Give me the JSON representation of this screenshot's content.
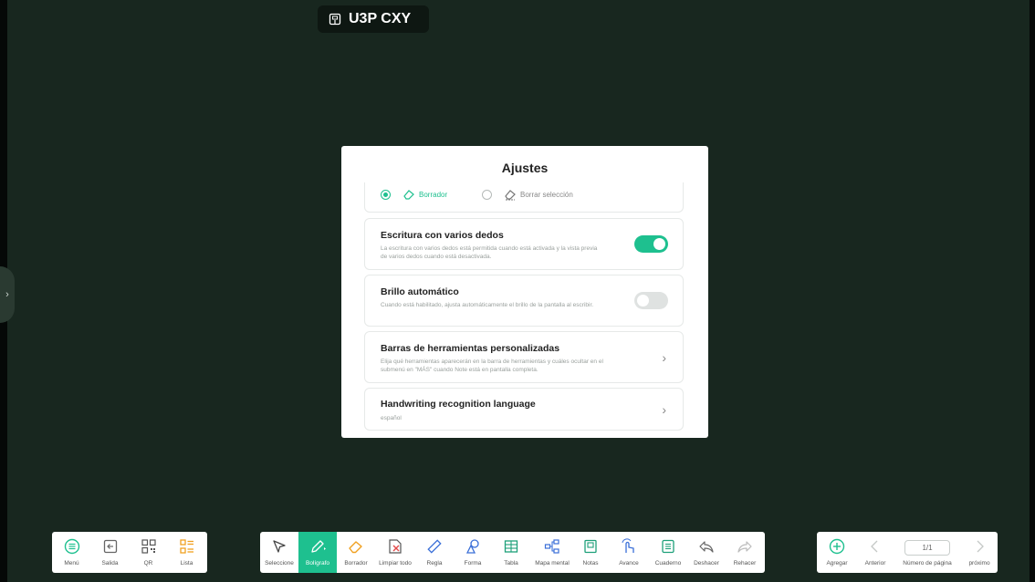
{
  "room": {
    "code": "U3P CXY"
  },
  "dialog": {
    "title": "Ajustes",
    "eraser": {
      "options": [
        {
          "label": "Borrador",
          "selected": true
        },
        {
          "label": "Borrar selección",
          "selected": false
        }
      ]
    },
    "settings": [
      {
        "title": "Escritura con varios dedos",
        "description": "La escritura con varios dedos está permitida cuando está activada y la vista previa de varios dedos cuando está desactivada.",
        "control": "toggle",
        "enabled": true
      },
      {
        "title": "Brillo automático",
        "description": "Cuando está habilitado, ajusta automáticamente el brillo de la pantalla al escribir.",
        "control": "toggle",
        "enabled": false
      },
      {
        "title": "Barras de herramientas personalizadas",
        "description": "Elija qué herramientas aparecerán en la barra de herramientas y cuáles ocultar en el submenú en \"MÁS\" cuando Note está en pantalla completa.",
        "control": "chevron"
      },
      {
        "title": "Handwriting recognition language",
        "description": "español",
        "control": "chevron"
      }
    ]
  },
  "toolbar_left": {
    "items": [
      {
        "label": "Menú",
        "icon": "menu-icon"
      },
      {
        "label": "Salida",
        "icon": "exit-icon"
      },
      {
        "label": "QR",
        "icon": "qr-icon"
      },
      {
        "label": "Lista",
        "icon": "list-icon"
      }
    ]
  },
  "toolbar_center": {
    "items": [
      {
        "label": "Seleccione",
        "icon": "select-icon"
      },
      {
        "label": "Bolígrafo",
        "icon": "pen-icon",
        "active": true
      },
      {
        "label": "Borrador",
        "icon": "eraser-icon"
      },
      {
        "label": "Limpiar todo",
        "icon": "clear-all-icon"
      },
      {
        "label": "Regla",
        "icon": "ruler-icon"
      },
      {
        "label": "Forma",
        "icon": "shape-icon"
      },
      {
        "label": "Tabla",
        "icon": "table-icon"
      },
      {
        "label": "Mapa mental",
        "icon": "mind-map-icon"
      },
      {
        "label": "Notas",
        "icon": "notes-icon"
      },
      {
        "label": "Avance",
        "icon": "advance-icon"
      },
      {
        "label": "Cuaderno",
        "icon": "notebook-icon"
      },
      {
        "label": "Deshacer",
        "icon": "undo-icon"
      },
      {
        "label": "Rehacer",
        "icon": "redo-icon"
      }
    ]
  },
  "toolbar_right": {
    "add_label": "Agregar",
    "prev_label": "Anterior",
    "page_indicator": "1/1",
    "page_number_label": "Número de página",
    "next_label": "próximo"
  },
  "colors": {
    "accent": "#1ec08f",
    "board": "#18271f"
  }
}
